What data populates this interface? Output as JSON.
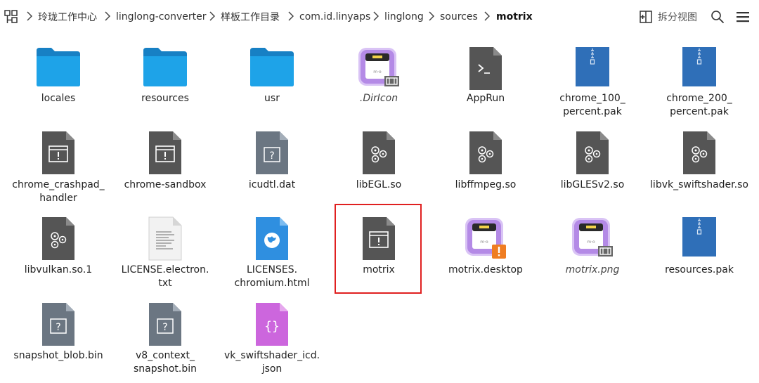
{
  "breadcrumb": [
    "玲珑工作中心",
    "linglong-converter",
    "样板工作目录",
    "com.id.linyaps",
    "linglong",
    "sources",
    "motrix"
  ],
  "toolbar": {
    "split_view_label": "拆分视图"
  },
  "files": [
    {
      "name": "locales",
      "icon": "folder-icon"
    },
    {
      "name": "resources",
      "icon": "folder-icon"
    },
    {
      "name": "usr",
      "icon": "folder-icon"
    },
    {
      "name": ".DirIcon",
      "icon": "motrix-image-icon",
      "italic": true
    },
    {
      "name": "AppRun",
      "icon": "terminal-script-icon"
    },
    {
      "name": "chrome_100_\npercent.pak",
      "icon": "archive-icon"
    },
    {
      "name": "chrome_200_\npercent.pak",
      "icon": "archive-icon"
    },
    {
      "name": "chrome_crashpad_\nhandler",
      "icon": "executable-icon"
    },
    {
      "name": "chrome-sandbox",
      "icon": "executable-icon"
    },
    {
      "name": "icudtl.dat",
      "icon": "unknown-file-icon"
    },
    {
      "name": "libEGL.so",
      "icon": "shared-library-icon"
    },
    {
      "name": "libffmpeg.so",
      "icon": "shared-library-icon"
    },
    {
      "name": "libGLESv2.so",
      "icon": "shared-library-icon"
    },
    {
      "name": "libvk_swiftshader.so",
      "icon": "shared-library-icon"
    },
    {
      "name": "libvulkan.so.1",
      "icon": "shared-library-icon"
    },
    {
      "name": "LICENSE.electron.\ntxt",
      "icon": "text-file-icon"
    },
    {
      "name": "LICENSES.\nchromium.html",
      "icon": "html-file-icon"
    },
    {
      "name": "motrix",
      "icon": "executable-icon",
      "selected": true
    },
    {
      "name": "motrix.desktop",
      "icon": "motrix-desktop-warning-icon"
    },
    {
      "name": "motrix.png",
      "icon": "motrix-image-icon",
      "italic": true
    },
    {
      "name": "resources.pak",
      "icon": "archive-icon"
    },
    {
      "name": "snapshot_blob.bin",
      "icon": "unknown-file-icon"
    },
    {
      "name": "v8_context_\nsnapshot.bin",
      "icon": "unknown-file-icon"
    },
    {
      "name": "vk_swiftshader_icd.\njson",
      "icon": "json-file-icon"
    }
  ],
  "colors": {
    "folder": "#1ea3e8",
    "doc_dark": "#555555",
    "archive": "#2f6fb8",
    "unknown": "#6b7682",
    "json": "#cc66dd",
    "html": "#2f8fe0",
    "motrix_purple": "#b48ae6",
    "warning": "#ef7d22",
    "selection": "#e02020"
  }
}
